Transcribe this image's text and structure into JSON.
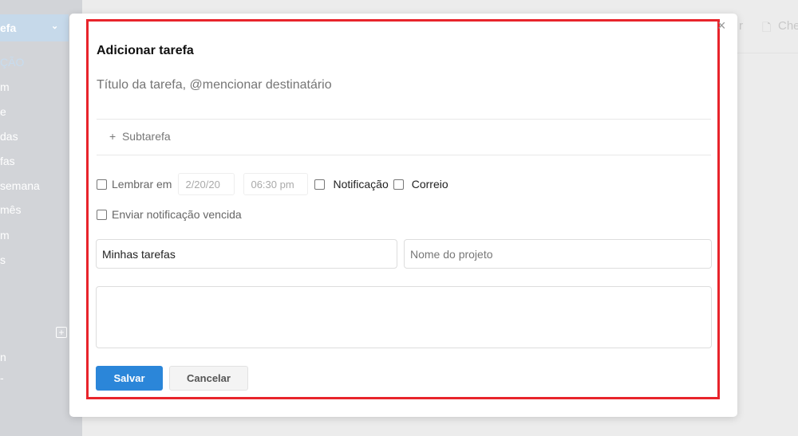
{
  "sidebar": {
    "active": "efa",
    "items": [
      "ÇÃO",
      "m",
      "e",
      "das",
      "fas",
      "semana",
      "mês",
      "m",
      "s",
      "n",
      "-"
    ]
  },
  "topbar": {
    "right_fragment": "r",
    "doc_label": "Che"
  },
  "modal": {
    "title": "Adicionar tarefa",
    "task_placeholder": "Título da tarefa, @mencionar destinatário",
    "subtask": "Subtarefa",
    "remind_label": "Lembrar em",
    "date": "2/20/20",
    "time": "06:30 pm",
    "notification_label": "Notificação",
    "mail_label": "Correio",
    "overdue_label": "Enviar notificação vencida",
    "list_value": "Minhas tarefas",
    "project_placeholder": "Nome do projeto",
    "save": "Salvar",
    "cancel": "Cancelar"
  }
}
